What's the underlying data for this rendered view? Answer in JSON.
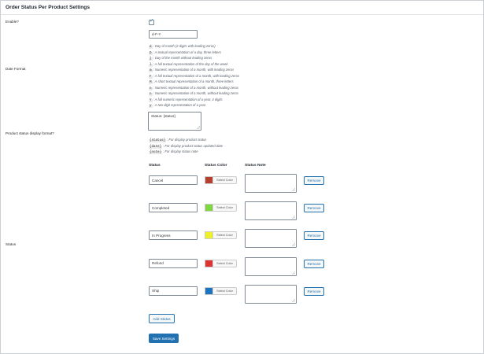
{
  "page": {
    "title": "Order Status Per Product Settings"
  },
  "settings": {
    "enable_label": "Enable?",
    "enable_checked": true,
    "date_format_label": "Date Format",
    "date_format_value": "d-F-Y",
    "date_format_help": [
      {
        "code": "d",
        "text": ": Day of month (2 digits with leading zeros)"
      },
      {
        "code": "D",
        "text": ": A textual representation of a day, three letters"
      },
      {
        "code": "j",
        "text": ": Day of the month without leading zeros"
      },
      {
        "code": "l",
        "text": ": A full textual representation of the day of the week"
      },
      {
        "code": "m",
        "text": ": Numeric representation of a month, with leading zeros"
      },
      {
        "code": "F",
        "text": ": A full textual representation of a month, with leading zeros"
      },
      {
        "code": "M",
        "text": ": A short textual representation of a month, three letters"
      },
      {
        "code": "n",
        "text": ": Numeric representation of a month, without leading zeros"
      },
      {
        "code": "n",
        "text": ": Numeric representation of a month, without leading zeros"
      },
      {
        "code": "Y",
        "text": ": A full numeric representation of a year, 4 digits"
      },
      {
        "code": "y",
        "text": ": A two digit representation of a year"
      }
    ],
    "display_format_label": "Product status display format?",
    "display_format_value": "Status: {status}",
    "display_format_help": [
      {
        "code": "{status}",
        "text": ": For display product status"
      },
      {
        "code": "{date}",
        "text": ": For display product status updated date"
      },
      {
        "code": "{note}",
        "text": ": For display status note"
      }
    ],
    "status_label": "Status"
  },
  "status_table": {
    "headers": {
      "status": "Status",
      "color": "Status Color",
      "note": "Status Note"
    },
    "select_color_label": "Select Color",
    "remove_label": "Remove",
    "rows": [
      {
        "name": "Cancel",
        "color": "#b5402e",
        "note": ""
      },
      {
        "name": "Completed",
        "color": "#7ed640",
        "note": ""
      },
      {
        "name": "In Progress",
        "color": "#eef02a",
        "note": ""
      },
      {
        "name": "Refund",
        "color": "#dd3333",
        "note": ""
      },
      {
        "name": "Ship",
        "color": "#1e73be",
        "note": ""
      }
    ]
  },
  "actions": {
    "add_status_label": "Add Status",
    "save_label": "Save Settings"
  }
}
